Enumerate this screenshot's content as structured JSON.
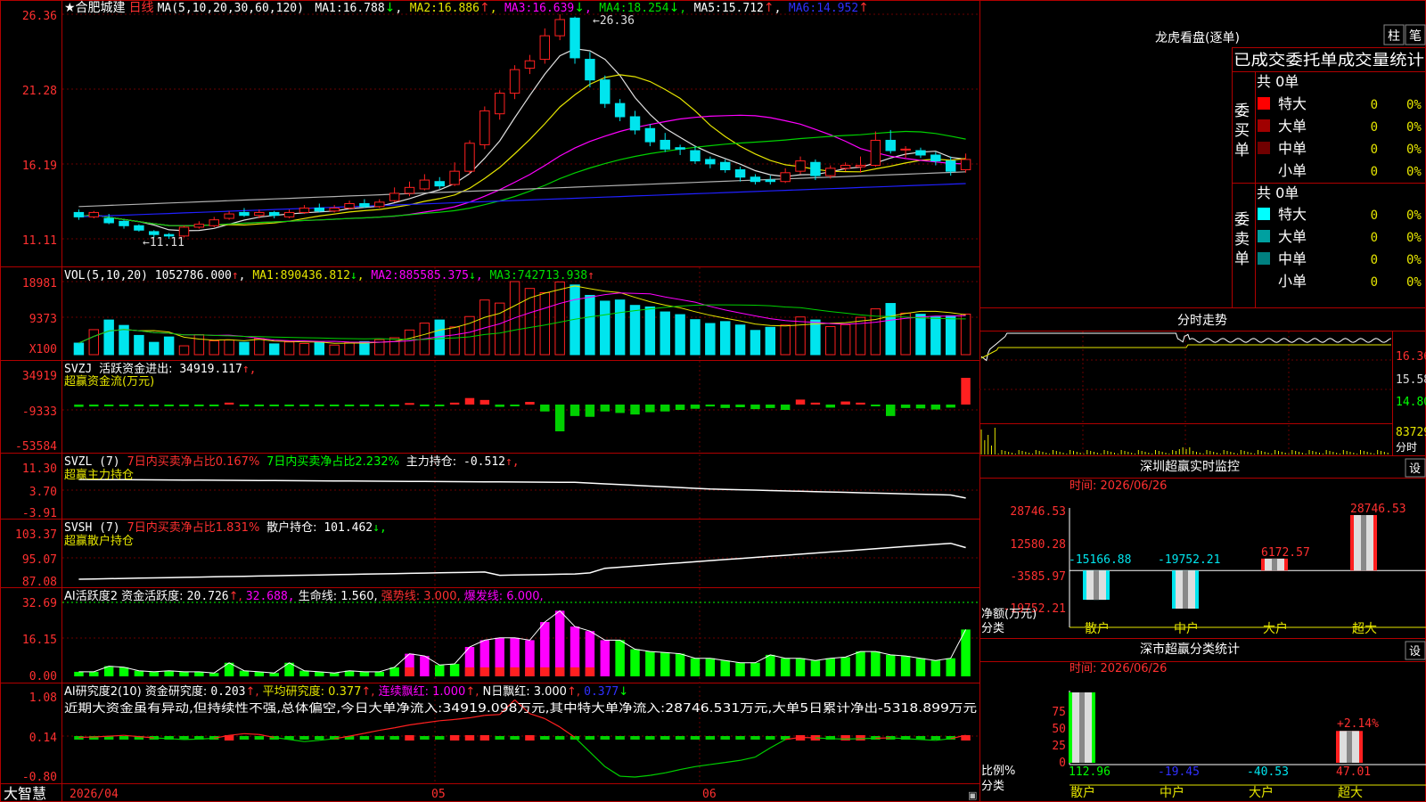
{
  "app": {
    "brand": "大智慧"
  },
  "colors": {
    "up": "#ff2020",
    "down": "#00e5ee",
    "bg": "#000000",
    "grid": "#8b0000",
    "ma1": "#e0e0e0",
    "ma2": "#e5e500",
    "ma3": "#ff00ff",
    "ma4": "#00d000",
    "ma5": "#b0b0b0",
    "ma6": "#2020ff"
  },
  "main": {
    "title": "★合肥城建",
    "period": "日线",
    "ma_params": "MA(5,10,20,30,60,120)",
    "ma": [
      {
        "name": "MA1:",
        "value": "16.788",
        "arrow": "↓",
        "color": "#ffffff"
      },
      {
        "name": "MA2:",
        "value": "16.886",
        "arrow": "↑",
        "color": "#e5e500"
      },
      {
        "name": "MA3:",
        "value": "16.639",
        "arrow": "↓",
        "color": "#ff00ff"
      },
      {
        "name": "MA4:",
        "value": "18.254",
        "arrow": "↓",
        "color": "#00e000"
      },
      {
        "name": "MA5:",
        "value": "15.712",
        "arrow": "↑",
        "color": "#ffffff"
      },
      {
        "name": "MA6:",
        "value": "14.952",
        "arrow": "↑",
        "color": "#3030ff"
      }
    ],
    "y_ticks": [
      "26.36",
      "21.28",
      "16.19",
      "11.11"
    ],
    "high_label": "26.36",
    "low_label": "11.11"
  },
  "volume": {
    "name": "VOL(5,10,20)",
    "value": "1052786.000",
    "ma": [
      {
        "name": "MA1:",
        "value": "890436.812",
        "arrow": "↓",
        "color": "#e5e500"
      },
      {
        "name": "MA2:",
        "value": "885585.375",
        "arrow": "↓",
        "color": "#ff00ff"
      },
      {
        "name": "MA3:",
        "value": "742713.938",
        "arrow": "↑",
        "color": "#00e000"
      }
    ],
    "y_ticks": [
      "18981",
      "9373",
      "X100"
    ]
  },
  "svzj": {
    "name": "SVZJ",
    "label": "活跃资金进出:",
    "value": "34919.117",
    "arrow": "↑,",
    "sub": "超赢资金流(万元)",
    "y_ticks": [
      "34919",
      "-9333",
      "-53584"
    ]
  },
  "svzl": {
    "name": "SVZL (7)",
    "t1": "7日内买卖净占比0.167%",
    "t2": "7日内买卖净占比2.232%",
    "t3": "主力持仓:",
    "value": "-0.512",
    "arrow": "↑,",
    "sub": "超赢主力持仓",
    "y_ticks": [
      "11.30",
      "3.70",
      "-3.91"
    ]
  },
  "svsh": {
    "name": "SVSH (7)",
    "t1": "7日内买卖净占比1.831%",
    "t3": "散户持仓:",
    "value": "101.462",
    "arrow": "↓,",
    "sub": "超赢散户持仓",
    "y_ticks": [
      "103.37",
      "95.07",
      "87.08"
    ]
  },
  "ai_act": {
    "name": "AI活跃度2",
    "label": "资金活跃度:",
    "v1": "20.726",
    "a1": "↑,",
    "v2": "32.688,",
    "life": "生命线: 1.560,",
    "strong": "强势线: 3.000,",
    "burst": "爆发线: 6.000,",
    "y_ticks": [
      "32.69",
      "16.15",
      "0.00"
    ]
  },
  "ai_res": {
    "name": "AI研究度2(10)",
    "label": "资金研究度:",
    "v1": "0.203",
    "a1": "↑,",
    "avg": "平均研究度: 0.377",
    "a2": "↑,",
    "cont": "连续飘红: 1.000",
    "a3": "↑,",
    "nred": "N日飘红: 3.000",
    "a4": "↑,",
    "v5": "0.377",
    "a5": "↓",
    "comment": "近期大资金虽有异动,但持续性不强,总体偏空,今日大单净流入:34919.098万元,其中特大单净流入:28746.531万元,大单5日累计净出-5318.899万元",
    "y_ticks": [
      "1.08",
      "0.14",
      "-0.80"
    ]
  },
  "x_labels": [
    "2026/04",
    "05",
    "06"
  ],
  "lhb": {
    "title": "龙虎看盘(逐单)",
    "btn1": "柱",
    "btn2": "笔",
    "header": "已成交委托单成交量统计",
    "buy_label": "委买单",
    "sell_label": "委卖单",
    "buy_total": "共 0单",
    "sell_total": "共 0单",
    "buy_rows": [
      {
        "label": "特大",
        "count": "0",
        "pct": "0%",
        "color": "#ff0000"
      },
      {
        "label": "大单",
        "count": "0",
        "pct": "0%",
        "color": "#a00000"
      },
      {
        "label": "中单",
        "count": "0",
        "pct": "0%",
        "color": "#700000"
      },
      {
        "label": "小单",
        "count": "0",
        "pct": "0%",
        "color": ""
      }
    ],
    "sell_rows": [
      {
        "label": "特大",
        "count": "0",
        "pct": "0%",
        "color": "#00ffff"
      },
      {
        "label": "大单",
        "count": "0",
        "pct": "0%",
        "color": "#00a0a0"
      },
      {
        "label": "中单",
        "count": "0",
        "pct": "0%",
        "color": "#008080"
      },
      {
        "label": "小单",
        "count": "0",
        "pct": "0%",
        "color": ""
      }
    ]
  },
  "intraday": {
    "title": "分时走势",
    "prices": [
      "16.36",
      "15.58",
      "14.80"
    ],
    "vol": "83729",
    "tag": "分时"
  },
  "sz_monitor": {
    "title": "深圳超赢实时监控",
    "btn": "设",
    "date": "时间: 2026/06/26",
    "y_ticks": [
      "28746.53",
      "12580.28",
      "-3585.97",
      "-19752.21"
    ],
    "ylabel": "净额(万元)",
    "xlabel": "分类",
    "bars": [
      {
        "label": "散户",
        "value": -15166.88,
        "text": "-15166.88"
      },
      {
        "label": "中户",
        "value": -19752.21,
        "text": "-19752.21"
      },
      {
        "label": "大户",
        "value": 6172.57,
        "text": "6172.57"
      },
      {
        "label": "超大",
        "value": 28746.53,
        "text": "28746.53"
      }
    ]
  },
  "sz_class": {
    "title": "深市超赢分类统计",
    "btn": "设",
    "date": "时间: 2026/06/26",
    "y_ticks": [
      "75",
      "50",
      "25",
      "0"
    ],
    "ylabel": "比例%",
    "xlabel": "分类",
    "annot": "+2.14%",
    "bars": [
      {
        "label": "散户",
        "value": 112.96,
        "text": "112.96"
      },
      {
        "label": "中户",
        "value": -19.45,
        "text": "-19.45"
      },
      {
        "label": "大户",
        "value": -40.53,
        "text": "-40.53"
      },
      {
        "label": "超大",
        "value": 47.01,
        "text": "47.01"
      }
    ]
  },
  "chart_data": [
    {
      "type": "candlestick",
      "title": "★合肥城建 日线",
      "ylim": [
        11.11,
        26.36
      ],
      "candles": [
        [
          12.9,
          12.6,
          13.1,
          12.4
        ],
        [
          12.6,
          12.9,
          13.0,
          12.5
        ],
        [
          12.5,
          12.2,
          12.8,
          12.1
        ],
        [
          12.3,
          12.0,
          12.4,
          11.8
        ],
        [
          12.0,
          11.7,
          12.1,
          11.6
        ],
        [
          11.6,
          11.4,
          11.7,
          11.2
        ],
        [
          11.4,
          11.3,
          11.5,
          11.11
        ],
        [
          11.3,
          11.9,
          12.0,
          11.2
        ],
        [
          11.9,
          12.1,
          12.3,
          11.8
        ],
        [
          12.0,
          12.4,
          12.6,
          11.9
        ],
        [
          12.5,
          12.8,
          13.0,
          12.4
        ],
        [
          12.9,
          12.7,
          13.2,
          12.6
        ],
        [
          12.7,
          12.9,
          13.1,
          12.5
        ],
        [
          12.9,
          12.7,
          13.0,
          12.5
        ],
        [
          12.6,
          12.9,
          13.1,
          12.5
        ],
        [
          12.9,
          13.2,
          13.4,
          12.8
        ],
        [
          13.2,
          13.0,
          13.5,
          12.9
        ],
        [
          13.0,
          13.2,
          13.4,
          12.9
        ],
        [
          13.2,
          13.5,
          13.7,
          13.1
        ],
        [
          13.5,
          13.3,
          13.8,
          13.2
        ],
        [
          13.3,
          13.6,
          13.8,
          13.2
        ],
        [
          13.7,
          14.2,
          14.6,
          13.6
        ],
        [
          14.2,
          14.6,
          15.0,
          14.0
        ],
        [
          14.5,
          15.1,
          15.5,
          14.4
        ],
        [
          15.0,
          14.7,
          15.3,
          14.5
        ],
        [
          14.8,
          15.7,
          16.3,
          14.7
        ],
        [
          15.7,
          17.6,
          17.8,
          15.5
        ],
        [
          17.5,
          19.8,
          20.1,
          17.2
        ],
        [
          19.6,
          21.0,
          21.2,
          19.2
        ],
        [
          21.0,
          22.6,
          22.9,
          20.6
        ],
        [
          22.7,
          23.2,
          23.6,
          22.3
        ],
        [
          23.3,
          24.9,
          25.4,
          23.0
        ],
        [
          24.9,
          26.0,
          26.36,
          24.6
        ],
        [
          26.1,
          23.4,
          26.2,
          23.0
        ],
        [
          23.3,
          21.9,
          23.8,
          21.4
        ],
        [
          21.9,
          20.3,
          22.2,
          20.0
        ],
        [
          20.3,
          19.4,
          20.6,
          19.1
        ],
        [
          19.4,
          18.5,
          19.8,
          18.2
        ],
        [
          18.6,
          17.7,
          18.9,
          17.4
        ],
        [
          17.8,
          17.2,
          18.3,
          17.0
        ],
        [
          17.3,
          17.2,
          17.5,
          16.8
        ],
        [
          17.1,
          16.4,
          17.4,
          16.2
        ],
        [
          16.5,
          16.2,
          16.7,
          15.9
        ],
        [
          16.3,
          15.8,
          16.5,
          15.6
        ],
        [
          15.8,
          15.3,
          16.0,
          15.0
        ],
        [
          15.3,
          15.0,
          15.5,
          14.8
        ],
        [
          15.1,
          15.0,
          15.4,
          14.8
        ],
        [
          15.0,
          15.6,
          15.9,
          14.9
        ],
        [
          15.7,
          16.4,
          16.7,
          15.5
        ],
        [
          16.3,
          15.4,
          16.5,
          15.1
        ],
        [
          15.4,
          15.9,
          16.1,
          15.2
        ],
        [
          15.9,
          16.1,
          16.3,
          15.7
        ],
        [
          16.0,
          16.1,
          16.7,
          15.6
        ],
        [
          16.1,
          17.8,
          18.4,
          16.0
        ],
        [
          17.8,
          17.1,
          18.5,
          16.9
        ],
        [
          17.2,
          17.2,
          17.4,
          16.6
        ],
        [
          17.1,
          16.8,
          17.3,
          16.6
        ],
        [
          16.8,
          16.4,
          17.0,
          16.1
        ],
        [
          16.4,
          15.7,
          16.7,
          15.4
        ],
        [
          15.8,
          16.5,
          16.9,
          15.6
        ]
      ]
    },
    {
      "type": "bar",
      "title": "VOL(5,10,20)",
      "ylim": [
        0,
        18981
      ],
      "values": [
        3000,
        6500,
        9000,
        7600,
        5000,
        3200,
        4600,
        2300,
        5200,
        3600,
        3800,
        3200,
        4200,
        2800,
        3300,
        2900,
        3200,
        2500,
        3100,
        3400,
        3900,
        4400,
        6400,
        8200,
        9000,
        7200,
        9900,
        14200,
        13400,
        18981,
        17200,
        16100,
        18900,
        18100,
        15400,
        13900,
        14200,
        12800,
        12400,
        11100,
        10400,
        9100,
        8100,
        8600,
        7700,
        6300,
        7100,
        7700,
        9800,
        9000,
        7300,
        7800,
        9700,
        11900,
        13300,
        10800,
        10500,
        9800,
        10100,
        10528
      ]
    },
    {
      "type": "bar",
      "title": "SVZJ 超赢资金流(万元)",
      "ylim": [
        -53584,
        34919
      ],
      "values": [
        -3000,
        -2500,
        -1500,
        -1000,
        -1500,
        -1000,
        -2000,
        -1000,
        -800,
        -1200,
        2500,
        -1500,
        -1200,
        -800,
        -2000,
        -1000,
        -1500,
        -1000,
        -800,
        -1200,
        -900,
        -1500,
        2000,
        -1500,
        -800,
        2500,
        8500,
        6000,
        -3000,
        -1500,
        3500,
        -9000,
        -35000,
        -15000,
        -16000,
        -9000,
        -11000,
        -13000,
        -10000,
        -9000,
        -7000,
        -5500,
        -2500,
        -4500,
        -3500,
        -6000,
        -4500,
        -7000,
        6500,
        2500,
        -4000,
        4000,
        2500,
        -1500,
        -15000,
        -4500,
        -5000,
        -6500,
        -4000,
        34919
      ]
    },
    {
      "type": "bar",
      "title": "AI活跃度2",
      "ylim": [
        0,
        32.69
      ],
      "values": [
        2,
        2,
        4.5,
        4,
        2.5,
        2,
        2.5,
        2,
        2,
        1.5,
        6,
        2.5,
        2,
        1.5,
        6,
        2.5,
        2,
        1.5,
        2.5,
        2,
        2,
        4,
        10,
        9,
        5,
        5.5,
        13,
        16,
        17,
        17,
        16,
        24,
        29,
        22,
        20,
        16,
        16,
        12,
        11,
        10.5,
        10,
        8,
        8,
        7,
        6,
        6,
        9.5,
        8,
        8,
        7,
        8,
        8.5,
        11,
        11,
        9.5,
        9,
        8,
        7,
        8,
        20.7
      ]
    },
    {
      "type": "line",
      "title": "AI研究度2(10)",
      "ylim": [
        -0.8,
        1.08
      ],
      "values": [
        0.15,
        0.16,
        0.18,
        0.2,
        0.17,
        0.14,
        0.12,
        0.1,
        0.11,
        0.13,
        0.2,
        0.24,
        0.22,
        0.15,
        0.1,
        0.05,
        0.08,
        0.12,
        0.18,
        0.25,
        0.32,
        0.38,
        0.45,
        0.5,
        0.55,
        0.58,
        0.62,
        0.68,
        0.7,
        1.05,
        0.72,
        0.6,
        0.4,
        0.15,
        -0.2,
        -0.55,
        -0.78,
        -0.8,
        -0.76,
        -0.7,
        -0.62,
        -0.55,
        -0.5,
        -0.45,
        -0.4,
        -0.32,
        -0.1,
        0.1,
        0.15,
        0.14,
        0.12,
        0.11,
        0.12,
        0.13,
        0.14,
        0.12,
        0.1,
        0.08,
        0.12,
        0.203
      ]
    },
    {
      "type": "bar",
      "title": "深圳超赢实时监控",
      "categories": [
        "散户",
        "中户",
        "大户",
        "超大"
      ],
      "values": [
        -15166.88,
        -19752.21,
        6172.57,
        28746.53
      ],
      "ylabel": "净额(万元)",
      "ylim": [
        -19752.21,
        28746.53
      ]
    },
    {
      "type": "bar",
      "title": "深市超赢分类统计",
      "categories": [
        "散户",
        "中户",
        "大户",
        "超大"
      ],
      "values": [
        112.96,
        -19.45,
        -40.53,
        47.01
      ],
      "ylabel": "比例%",
      "ylim": [
        0,
        75
      ]
    }
  ]
}
